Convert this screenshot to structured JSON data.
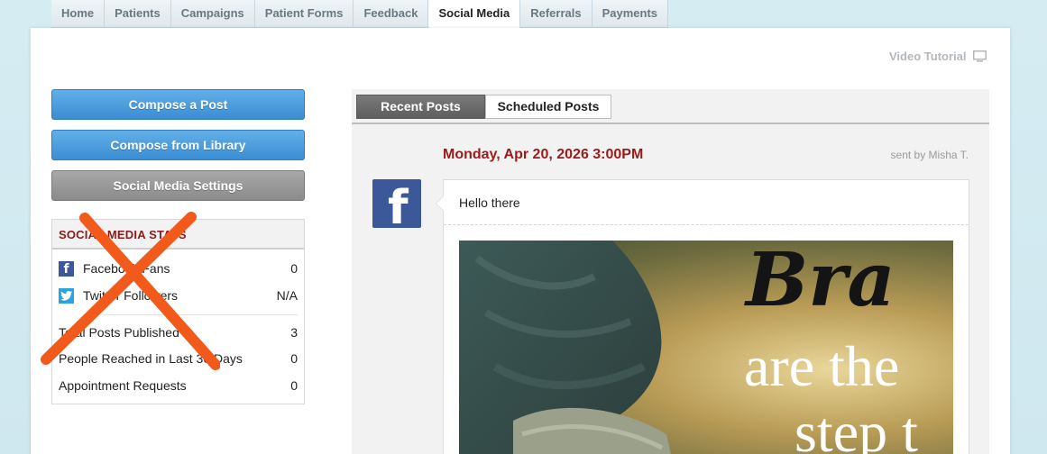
{
  "nav": {
    "tabs": [
      "Home",
      "Patients",
      "Campaigns",
      "Patient Forms",
      "Feedback",
      "Social Media",
      "Referrals",
      "Payments"
    ],
    "active": "Social Media"
  },
  "video_tutorial": {
    "label": "Video Tutorial",
    "icon": "monitor-icon"
  },
  "actions": {
    "compose_post": "Compose a Post",
    "compose_library": "Compose from Library",
    "settings": "Social Media Settings"
  },
  "stats": {
    "title": "SOCIAL MEDIA STATS",
    "facebook_fans": {
      "label": "Facebook Fans",
      "value": "0"
    },
    "twitter_followers": {
      "label": "Twitter Followers",
      "value": "N/A"
    },
    "total_posts": {
      "label": "Total Posts Published",
      "value": "3"
    },
    "people_reached": {
      "label": "People Reached in Last 30 Days",
      "value": "0"
    },
    "appointment_requests": {
      "label": "Appointment Requests",
      "value": "0"
    }
  },
  "feed": {
    "tabs": {
      "recent": "Recent Posts",
      "scheduled": "Scheduled Posts"
    },
    "post": {
      "date": "Monday, Apr 20, 2026 3:00PM",
      "sent_by": "sent by Misha T.",
      "text": "Hello there",
      "image_text": {
        "line1": "Bra",
        "line2": "are the",
        "line3": "step t"
      }
    }
  },
  "colors": {
    "accent_red": "#9b1b1b",
    "button_blue": "#3b8dd3",
    "facebook": "#3b5998",
    "twitter": "#2aa3e0",
    "x_mark": "#f25a1c"
  }
}
